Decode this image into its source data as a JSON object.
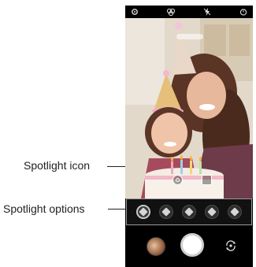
{
  "callouts": {
    "spotlight_icon": "Spotlight icon",
    "spotlight_options": "Spotlight options"
  },
  "status_bar": {
    "icons": [
      "settings-icon",
      "filter-icon",
      "flash-off-icon",
      "timer-icon"
    ]
  },
  "viewfinder": {
    "scene": "photo of a woman and a girl in party hats with a birthday cake",
    "buttons": [
      "spotlight-icon",
      "gallery-icon"
    ]
  },
  "spotlight_options": {
    "count": 5,
    "selected_index": 0
  },
  "controls": {
    "icons": [
      "gallery-thumbnail",
      "shutter-button",
      "switch-camera-icon"
    ]
  },
  "colors": {
    "background": "#ffffff",
    "phone_bg": "#000000",
    "options_border": "#9a9a9a"
  }
}
